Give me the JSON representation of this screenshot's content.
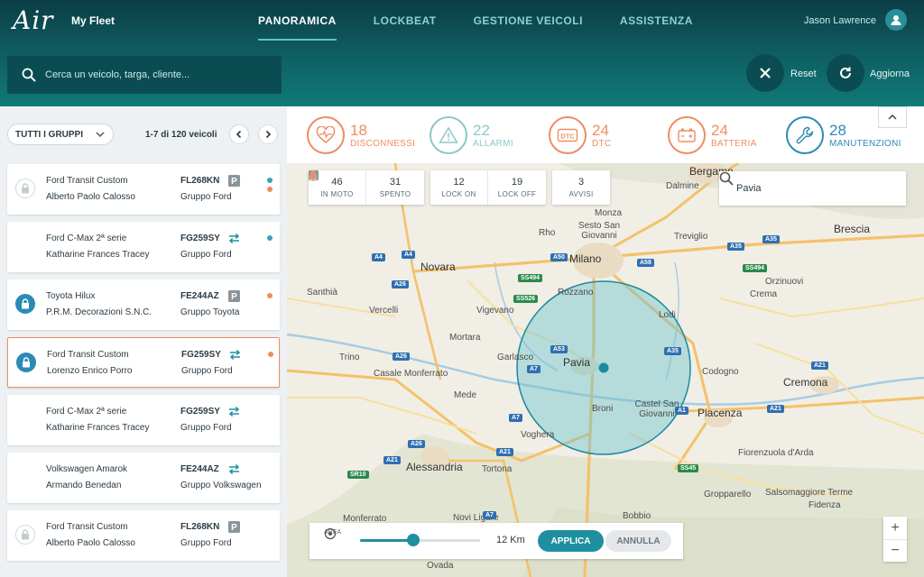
{
  "header": {
    "logo": "Air",
    "app_name": "My Fleet",
    "nav": [
      {
        "label": "PANORAMICA",
        "active": true
      },
      {
        "label": "LOCKBEAT",
        "active": false
      },
      {
        "label": "GESTIONE VEICOLI",
        "active": false
      },
      {
        "label": "ASSISTENZA",
        "active": false
      }
    ],
    "user_name": "Jason Lawrence",
    "search_placeholder": "Cerca un veicolo, targa, cliente...",
    "reset_label": "Reset",
    "refresh_label": "Aggiorna"
  },
  "sidebar": {
    "group_filter": "TUTTI I GRUPPI",
    "pagination": "1-7 di 120 veicoli",
    "vehicles": [
      {
        "model": "Ford Transit Custom",
        "driver": "Alberto Paolo Calosso",
        "plate": "FL268KN",
        "group": "Gruppo Ford",
        "lock": "off",
        "status": "parked",
        "dots": [
          "#3aa0b8",
          "#f08a5d"
        ]
      },
      {
        "model": "Ford C-Max 2ª serie",
        "driver": "Katharine Frances Tracey",
        "plate": "FG259SY",
        "group": "Gruppo Ford",
        "lock": "none",
        "status": "moving",
        "dots": [
          "#3aa0b8"
        ]
      },
      {
        "model": "Toyota Hilux",
        "driver": "P.R.M. Decorazioni S.N.C.",
        "plate": "FE244AZ",
        "group": "Gruppo Toyota",
        "lock": "on",
        "status": "parked",
        "dots": [
          "#f08a5d"
        ]
      },
      {
        "model": "Ford Transit Custom",
        "driver": "Lorenzo Enrico Porro",
        "plate": "FG259SY",
        "group": "Gruppo Ford",
        "lock": "on",
        "status": "moving",
        "dots": [
          "#f08a5d"
        ],
        "selected": true
      },
      {
        "model": "Ford C-Max 2ª serie",
        "driver": "Katharine Frances Tracey",
        "plate": "FG259SY",
        "group": "Gruppo Ford",
        "lock": "none",
        "status": "moving",
        "dots": []
      },
      {
        "model": "Volkswagen Amarok",
        "driver": "Armando Benedan",
        "plate": "FE244AZ",
        "group": "Gruppo Volkswagen",
        "lock": "none",
        "status": "moving",
        "dots": []
      },
      {
        "model": "Ford Transit Custom",
        "driver": "Alberto Paolo Calosso",
        "plate": "FL268KN",
        "group": "Gruppo Ford",
        "lock": "off",
        "status": "parked",
        "dots": []
      }
    ]
  },
  "stats": [
    {
      "icon": "heart-pulse-icon",
      "value": "18",
      "label": "DISCONNESSI",
      "color": "#ee8d63"
    },
    {
      "icon": "warning-icon",
      "value": "22",
      "label": "ALLARMI",
      "color": "#8cc9c4"
    },
    {
      "icon": "dtc-icon",
      "value": "24",
      "label": "DTC",
      "color": "#ee8d63"
    },
    {
      "icon": "battery-icon",
      "value": "24",
      "label": "BATTERIA",
      "color": "#ee8d63"
    },
    {
      "icon": "wrench-icon",
      "value": "28",
      "label": "MANUTENZIONI",
      "color": "#2b8bb4"
    }
  ],
  "map": {
    "chips": {
      "moving": {
        "value": "46",
        "label": "IN MOTO"
      },
      "off": {
        "value": "31",
        "label": "SPENTO"
      },
      "lock_on": {
        "value": "12",
        "label": "LOCK ON"
      },
      "lock_off": {
        "value": "19",
        "label": "LOCK OFF"
      },
      "alerts": {
        "value": "3",
        "label": "AVVISI"
      }
    },
    "search_value": "Pavia",
    "area_label": "AREA",
    "radius": "12 Km",
    "radius_fraction": 0.44,
    "apply_label": "APPLICA",
    "cancel_label": "ANNULLA",
    "zoom_in": "+",
    "zoom_out": "−",
    "places": [
      "Bergamo",
      "Dalmine",
      "Monza",
      "Sesto San Giovanni",
      "Rho",
      "Treviglio",
      "Brescia",
      "Novara",
      "Milano",
      "Santhià",
      "Vigevano",
      "Rozzano",
      "Crema",
      "Orzinuovi",
      "Vercelli",
      "Lodi",
      "Mortara",
      "Garlasco",
      "Pavia",
      "Trino",
      "Casale Monferrato",
      "Codogno",
      "Cremona",
      "Mede",
      "Broni",
      "Castel San Giovanni",
      "Piacenza",
      "Voghera",
      "Alessandria",
      "Tortona",
      "Fiorenzuola d'Arda",
      "Monferrato",
      "Novi Ligure",
      "Salsomaggiore Terme",
      "Gropparello",
      "Bobbio",
      "Fidenza",
      "Ovada"
    ]
  }
}
